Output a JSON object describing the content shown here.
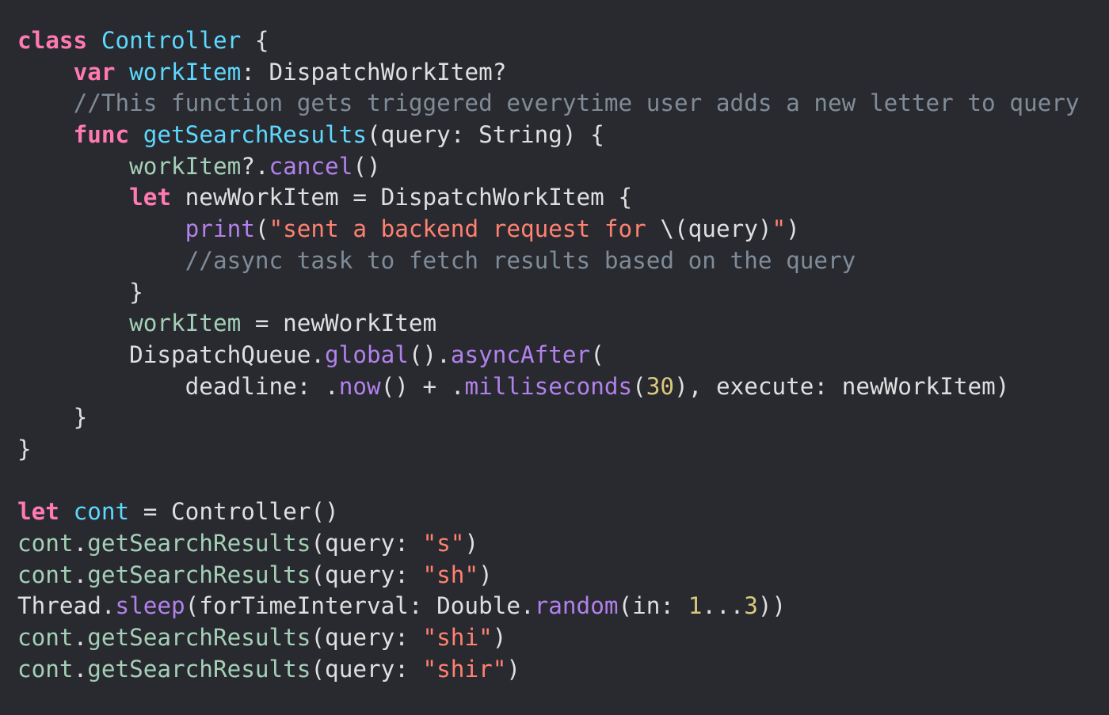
{
  "theme": {
    "background": "#292a30",
    "keyword": "#ff7ab2",
    "string": "#ff8170",
    "number": "#d9c97c",
    "comment": "#7f8c98",
    "plain": "#dfdfe0"
  },
  "code": {
    "lines": [
      [
        {
          "t": "class",
          "c": "kw"
        },
        {
          "t": " ",
          "c": "plain"
        },
        {
          "t": "Controller",
          "c": "uidecl"
        },
        {
          "t": " {",
          "c": "plain"
        }
      ],
      [
        {
          "t": "    ",
          "c": "plain"
        },
        {
          "t": "var",
          "c": "kw"
        },
        {
          "t": " ",
          "c": "plain"
        },
        {
          "t": "workItem",
          "c": "uidecl"
        },
        {
          "t": ": DispatchWorkItem?",
          "c": "plain"
        }
      ],
      [
        {
          "t": "    ",
          "c": "plain"
        },
        {
          "t": "//This function gets triggered everytime user adds a new letter to query",
          "c": "cmt"
        }
      ],
      [
        {
          "t": "    ",
          "c": "plain"
        },
        {
          "t": "func",
          "c": "kw"
        },
        {
          "t": " ",
          "c": "plain"
        },
        {
          "t": "getSearchResults",
          "c": "uidecl"
        },
        {
          "t": "(query: String) {",
          "c": "plain"
        }
      ],
      [
        {
          "t": "        ",
          "c": "plain"
        },
        {
          "t": "workItem",
          "c": "prop"
        },
        {
          "t": "?.",
          "c": "plain"
        },
        {
          "t": "cancel",
          "c": "apifn"
        },
        {
          "t": "()",
          "c": "plain"
        }
      ],
      [
        {
          "t": "        ",
          "c": "plain"
        },
        {
          "t": "let",
          "c": "kw"
        },
        {
          "t": " newWorkItem = DispatchWorkItem {",
          "c": "plain"
        }
      ],
      [
        {
          "t": "            ",
          "c": "plain"
        },
        {
          "t": "print",
          "c": "apifn"
        },
        {
          "t": "(",
          "c": "plain"
        },
        {
          "t": "\"sent a backend request for ",
          "c": "str"
        },
        {
          "t": "\\(query)",
          "c": "plain"
        },
        {
          "t": "\"",
          "c": "str"
        },
        {
          "t": ")",
          "c": "plain"
        }
      ],
      [
        {
          "t": "            ",
          "c": "plain"
        },
        {
          "t": "//async task to fetch results based on the query",
          "c": "cmt"
        }
      ],
      [
        {
          "t": "        ",
          "c": "plain"
        },
        {
          "t": "}",
          "c": "plain"
        }
      ],
      [
        {
          "t": "        ",
          "c": "plain"
        },
        {
          "t": "workItem",
          "c": "prop"
        },
        {
          "t": " = newWorkItem",
          "c": "plain"
        }
      ],
      [
        {
          "t": "        ",
          "c": "plain"
        },
        {
          "t": "DispatchQueue.",
          "c": "plain"
        },
        {
          "t": "global",
          "c": "apifn"
        },
        {
          "t": "().",
          "c": "plain"
        },
        {
          "t": "asyncAfter",
          "c": "apifn"
        },
        {
          "t": "(",
          "c": "plain"
        }
      ],
      [
        {
          "t": "            ",
          "c": "plain"
        },
        {
          "t": "deadline: .",
          "c": "plain"
        },
        {
          "t": "now",
          "c": "apifn"
        },
        {
          "t": "() + .",
          "c": "plain"
        },
        {
          "t": "milliseconds",
          "c": "apifn"
        },
        {
          "t": "(",
          "c": "plain"
        },
        {
          "t": "30",
          "c": "num"
        },
        {
          "t": "), execute: newWorkItem)",
          "c": "plain"
        }
      ],
      [
        {
          "t": "    ",
          "c": "plain"
        },
        {
          "t": "}",
          "c": "plain"
        }
      ],
      [
        {
          "t": "}",
          "c": "plain"
        }
      ],
      [
        {
          "t": "",
          "c": "plain"
        }
      ],
      [
        {
          "t": "let",
          "c": "kw"
        },
        {
          "t": " ",
          "c": "plain"
        },
        {
          "t": "cont",
          "c": "uidecl"
        },
        {
          "t": " = Controller()",
          "c": "plain"
        }
      ],
      [
        {
          "t": "cont",
          "c": "prop"
        },
        {
          "t": ".",
          "c": "plain"
        },
        {
          "t": "getSearchResults",
          "c": "fn"
        },
        {
          "t": "(query: ",
          "c": "plain"
        },
        {
          "t": "\"s\"",
          "c": "str"
        },
        {
          "t": ")",
          "c": "plain"
        }
      ],
      [
        {
          "t": "cont",
          "c": "prop"
        },
        {
          "t": ".",
          "c": "plain"
        },
        {
          "t": "getSearchResults",
          "c": "fn"
        },
        {
          "t": "(query: ",
          "c": "plain"
        },
        {
          "t": "\"sh\"",
          "c": "str"
        },
        {
          "t": ")",
          "c": "plain"
        }
      ],
      [
        {
          "t": "Thread.",
          "c": "plain"
        },
        {
          "t": "sleep",
          "c": "apifn"
        },
        {
          "t": "(forTimeInterval: Double.",
          "c": "plain"
        },
        {
          "t": "random",
          "c": "apifn"
        },
        {
          "t": "(in: ",
          "c": "plain"
        },
        {
          "t": "1",
          "c": "num"
        },
        {
          "t": "...",
          "c": "plain"
        },
        {
          "t": "3",
          "c": "num"
        },
        {
          "t": "))",
          "c": "plain"
        }
      ],
      [
        {
          "t": "cont",
          "c": "prop"
        },
        {
          "t": ".",
          "c": "plain"
        },
        {
          "t": "getSearchResults",
          "c": "fn"
        },
        {
          "t": "(query: ",
          "c": "plain"
        },
        {
          "t": "\"shi\"",
          "c": "str"
        },
        {
          "t": ")",
          "c": "plain"
        }
      ],
      [
        {
          "t": "cont",
          "c": "prop"
        },
        {
          "t": ".",
          "c": "plain"
        },
        {
          "t": "getSearchResults",
          "c": "fn"
        },
        {
          "t": "(query: ",
          "c": "plain"
        },
        {
          "t": "\"shir\"",
          "c": "str"
        },
        {
          "t": ")",
          "c": "plain"
        }
      ]
    ]
  }
}
